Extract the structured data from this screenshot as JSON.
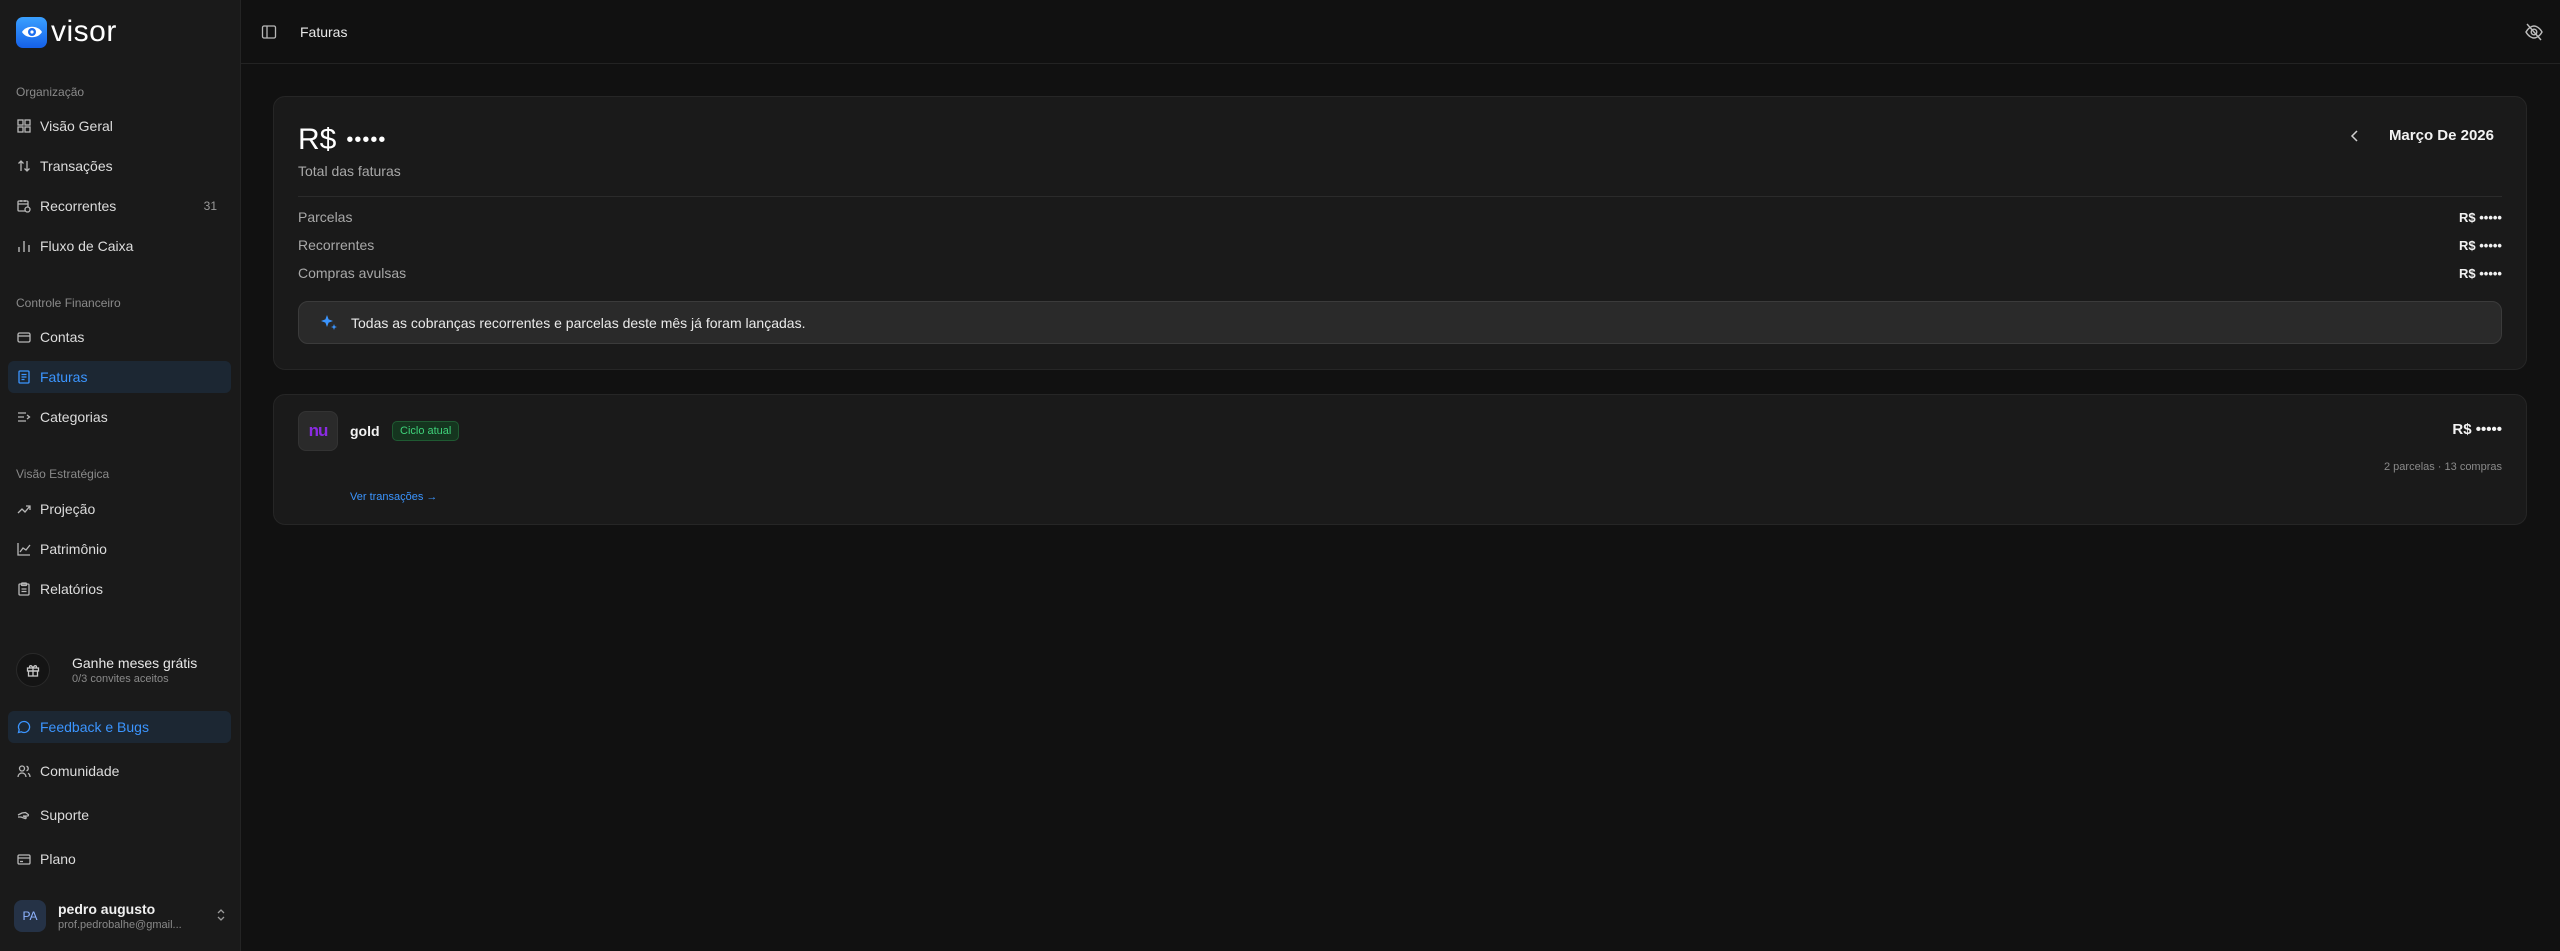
{
  "app": {
    "name": "visor"
  },
  "sidebar": {
    "sections": [
      {
        "label": "Organização"
      },
      {
        "label": "Controle Financeiro"
      },
      {
        "label": "Visão Estratégica"
      }
    ],
    "items": [
      {
        "label": "Visão Geral",
        "icon": "grid-icon"
      },
      {
        "label": "Transações",
        "icon": "arrows-updown-icon"
      },
      {
        "label": "Recorrentes",
        "icon": "calendar-clock-icon",
        "count": "31"
      },
      {
        "label": "Fluxo de Caixa",
        "icon": "bar-chart-icon"
      },
      {
        "label": "Contas",
        "icon": "wallet-icon"
      },
      {
        "label": "Faturas",
        "icon": "receipt-icon",
        "active": true
      },
      {
        "label": "Categorias",
        "icon": "list-filter-icon"
      },
      {
        "label": "Projeção",
        "icon": "trending-up-icon"
      },
      {
        "label": "Patrimônio",
        "icon": "chart-area-icon"
      },
      {
        "label": "Relatórios",
        "icon": "clipboard-icon"
      }
    ],
    "promo": {
      "title": "Ganhe meses grátis",
      "subtitle": "0/3 convites aceitos",
      "icon": "gift-icon"
    },
    "footer_items": [
      {
        "label": "Feedback e Bugs",
        "icon": "message-circle-icon",
        "active": true
      },
      {
        "label": "Comunidade",
        "icon": "users-icon"
      },
      {
        "label": "Suporte",
        "icon": "hand-icon"
      },
      {
        "label": "Plano",
        "icon": "credit-card-icon"
      }
    ],
    "user": {
      "initials": "PA",
      "name": "pedro augusto",
      "email": "prof.pedrobalhe@gmail..."
    }
  },
  "topbar": {
    "title": "Faturas"
  },
  "summary": {
    "total_currency": "R$",
    "total_hidden": "•••••",
    "total_label": "Total das faturas",
    "month": "Março De 2026",
    "rows": [
      {
        "label": "Parcelas",
        "value": "R$ •••••"
      },
      {
        "label": "Recorrentes",
        "value": "R$ •••••"
      },
      {
        "label": "Compras avulsas",
        "value": "R$ •••••"
      }
    ],
    "notice": "Todas as cobranças recorrentes e parcelas deste mês já foram lançadas."
  },
  "invoices": [
    {
      "bank_logo": "nu",
      "name": "gold",
      "badge": "Ciclo atual",
      "amount": "R$ •••••",
      "meta": "2 parcelas · 13 compras",
      "link": "Ver transações →"
    }
  ],
  "colors": {
    "accent": "#3b95ff",
    "badge_green": "#3fd17a",
    "bank_purple": "#8a2be2"
  }
}
